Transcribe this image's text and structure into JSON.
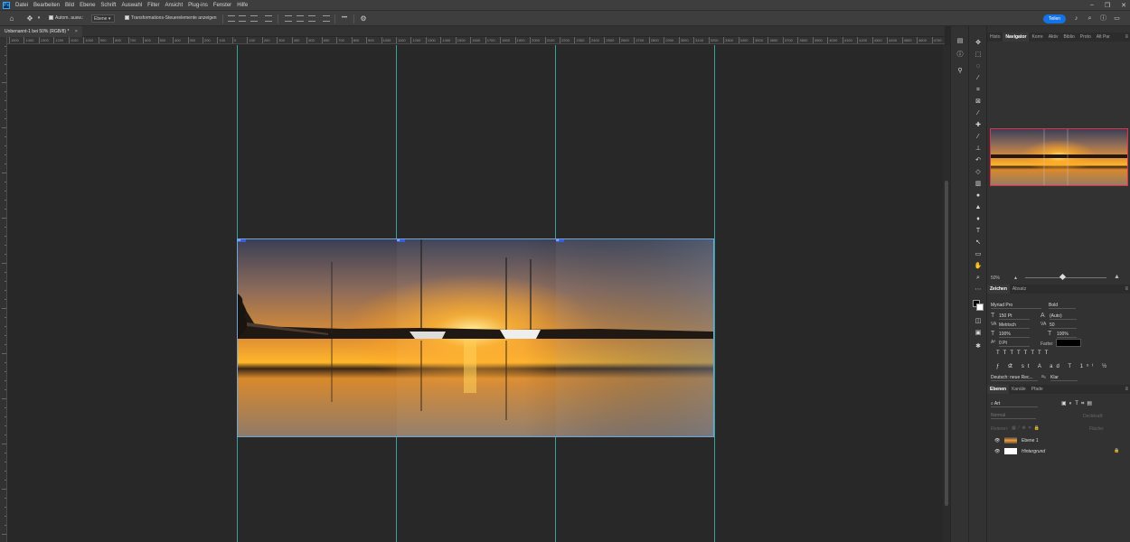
{
  "app": {
    "logo": "Ps"
  },
  "menu": [
    "Datei",
    "Bearbeiten",
    "Bild",
    "Ebene",
    "Schrift",
    "Auswahl",
    "Filter",
    "Ansicht",
    "Plug-ins",
    "Fenster",
    "Hilfe"
  ],
  "options_bar": {
    "auto_select_label": "Autom. ausw.:",
    "auto_select_value": "Ebene",
    "transform_label": "Transformations-Steuerelemente anzeigen",
    "more_label": "•••",
    "share_label": "Teilen"
  },
  "document": {
    "tab_title": "Unbenannt-1 bei 50% (RGB/8) *",
    "close_label": "×"
  },
  "rulers": {
    "h_ticks": [
      "1500",
      "1400",
      "1300",
      "1200",
      "1100",
      "1000",
      "900",
      "800",
      "700",
      "600",
      "500",
      "400",
      "300",
      "200",
      "100",
      "0",
      "100",
      "200",
      "300",
      "400",
      "500",
      "600",
      "700",
      "800",
      "900",
      "1000",
      "1100",
      "1200",
      "1300",
      "1400",
      "1500",
      "1600",
      "1700",
      "1800",
      "1900",
      "2000",
      "2100",
      "2200",
      "2300",
      "2400",
      "2500",
      "2600",
      "2700",
      "2800",
      "2900",
      "3000",
      "3100",
      "3200",
      "3300",
      "3400",
      "3500",
      "3600",
      "3700",
      "3800",
      "3900",
      "4000",
      "4100",
      "4200",
      "4300",
      "4400",
      "4500",
      "4600",
      "4700"
    ]
  },
  "slices": [
    "01",
    "02",
    "03"
  ],
  "panels": {
    "top_tabs": [
      "Histo",
      "Navigator",
      "Korre",
      "Aktiv",
      "Biblio",
      "Proto",
      "Alt Par"
    ],
    "navigator_zoom": "50%",
    "type_tabs": [
      "Zeichen",
      "Absatz"
    ],
    "font_family": "Myriad Pro",
    "font_style": "Bold",
    "font_size": "150 Pt",
    "leading": "(Auto)",
    "kerning": "Metrisch",
    "tracking": "50",
    "vscale": "100%",
    "hscale": "100%",
    "baseline": "0 Pt",
    "color_label": "Farbe:",
    "language": "Deutsch: neue Rec...",
    "antialias": "Klar",
    "layer_tabs": [
      "Ebenen",
      "Kanäle",
      "Pfade"
    ],
    "filter_label": "Art",
    "blend_mode": "Normal",
    "opacity_label": "Deckkraft:",
    "fix_label": "Fixieren:",
    "fill_label": "Fläche:",
    "layers": [
      {
        "name": "Ebene 1"
      },
      {
        "name": "Hintergrund"
      }
    ]
  }
}
